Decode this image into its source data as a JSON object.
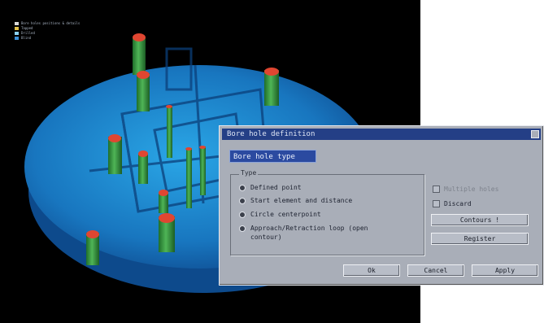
{
  "legend": {
    "items": [
      {
        "label": "Bore holes positions & details",
        "color": "#d8d8d8"
      },
      {
        "label": "Tapped",
        "color": "#e2c14a"
      },
      {
        "label": "Drilled",
        "color": "#8ad0f0"
      },
      {
        "label": "Blind",
        "color": "#3a8fd8"
      }
    ]
  },
  "dialog": {
    "title": "Bore hole definition",
    "tab_label": "Bore hole type",
    "group_label": "Type",
    "radio_options": [
      "Defined point",
      "Start element and distance",
      "Circle centerpoint",
      "Approach/Retraction loop (open contour)"
    ],
    "checkboxes": [
      {
        "label": "Multiple holes",
        "enabled": false
      },
      {
        "label": "Discard",
        "enabled": true
      }
    ],
    "buttons": {
      "contours": "Contours !",
      "register": "Register",
      "ok": "Ok",
      "cancel": "Cancel",
      "apply": "Apply"
    }
  },
  "colors": {
    "plate": "#1a7fc4",
    "pin": "#2f8f3a",
    "pin_top": "#d9412f",
    "title_bar": "#243f86"
  }
}
